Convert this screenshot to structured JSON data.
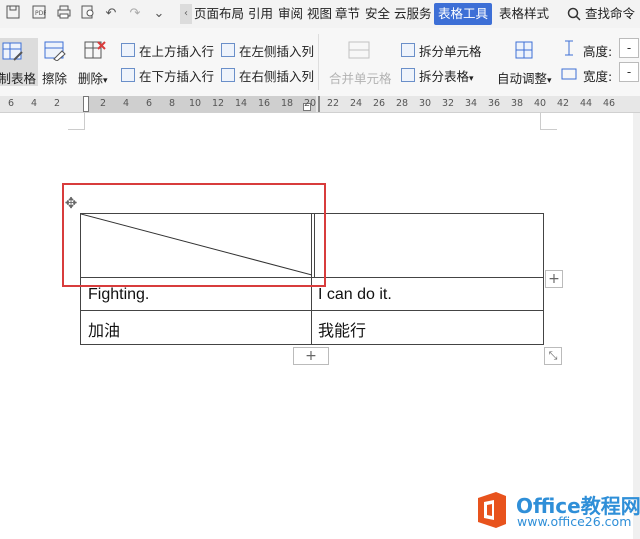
{
  "menu_bar": {
    "tabs": [
      "页面布局",
      "引用",
      "审阅",
      "视图",
      "章节",
      "安全",
      "云服务",
      "表格工具",
      "表格样式"
    ],
    "active_tab": "表格工具",
    "search_label": "查找命令"
  },
  "ribbon": {
    "draw_table": "绘制表格",
    "eraser": "擦除",
    "delete": "删除",
    "insert_row_above": "在上方插入行",
    "insert_row_below": "在下方插入行",
    "insert_col_left": "在左侧插入列",
    "insert_col_right": "在右侧插入列",
    "merge_cells": "合并单元格",
    "split_cells": "拆分单元格",
    "split_table": "拆分表格",
    "auto_fit": "自动调整",
    "height_label": "高度:",
    "width_label": "宽度:",
    "height_value": "-",
    "width_value": "-"
  },
  "ruler": {
    "ticks": [
      "6",
      "4",
      "2",
      "2",
      "4",
      "6",
      "8",
      "10",
      "12",
      "14",
      "16",
      "18",
      "20",
      "22",
      "24",
      "26",
      "28",
      "30",
      "32",
      "34",
      "36",
      "38",
      "40",
      "42",
      "44",
      "46"
    ]
  },
  "table": {
    "rows": [
      [
        "",
        ""
      ],
      [
        "Fighting.",
        "I can do it."
      ],
      [
        "加油",
        "我能行"
      ]
    ],
    "has_diagonal_header": true
  },
  "watermark": {
    "brand": "Office教程网",
    "url": "www.office26.com",
    "color": "#2f8fd8",
    "accent": "#e8531d"
  }
}
